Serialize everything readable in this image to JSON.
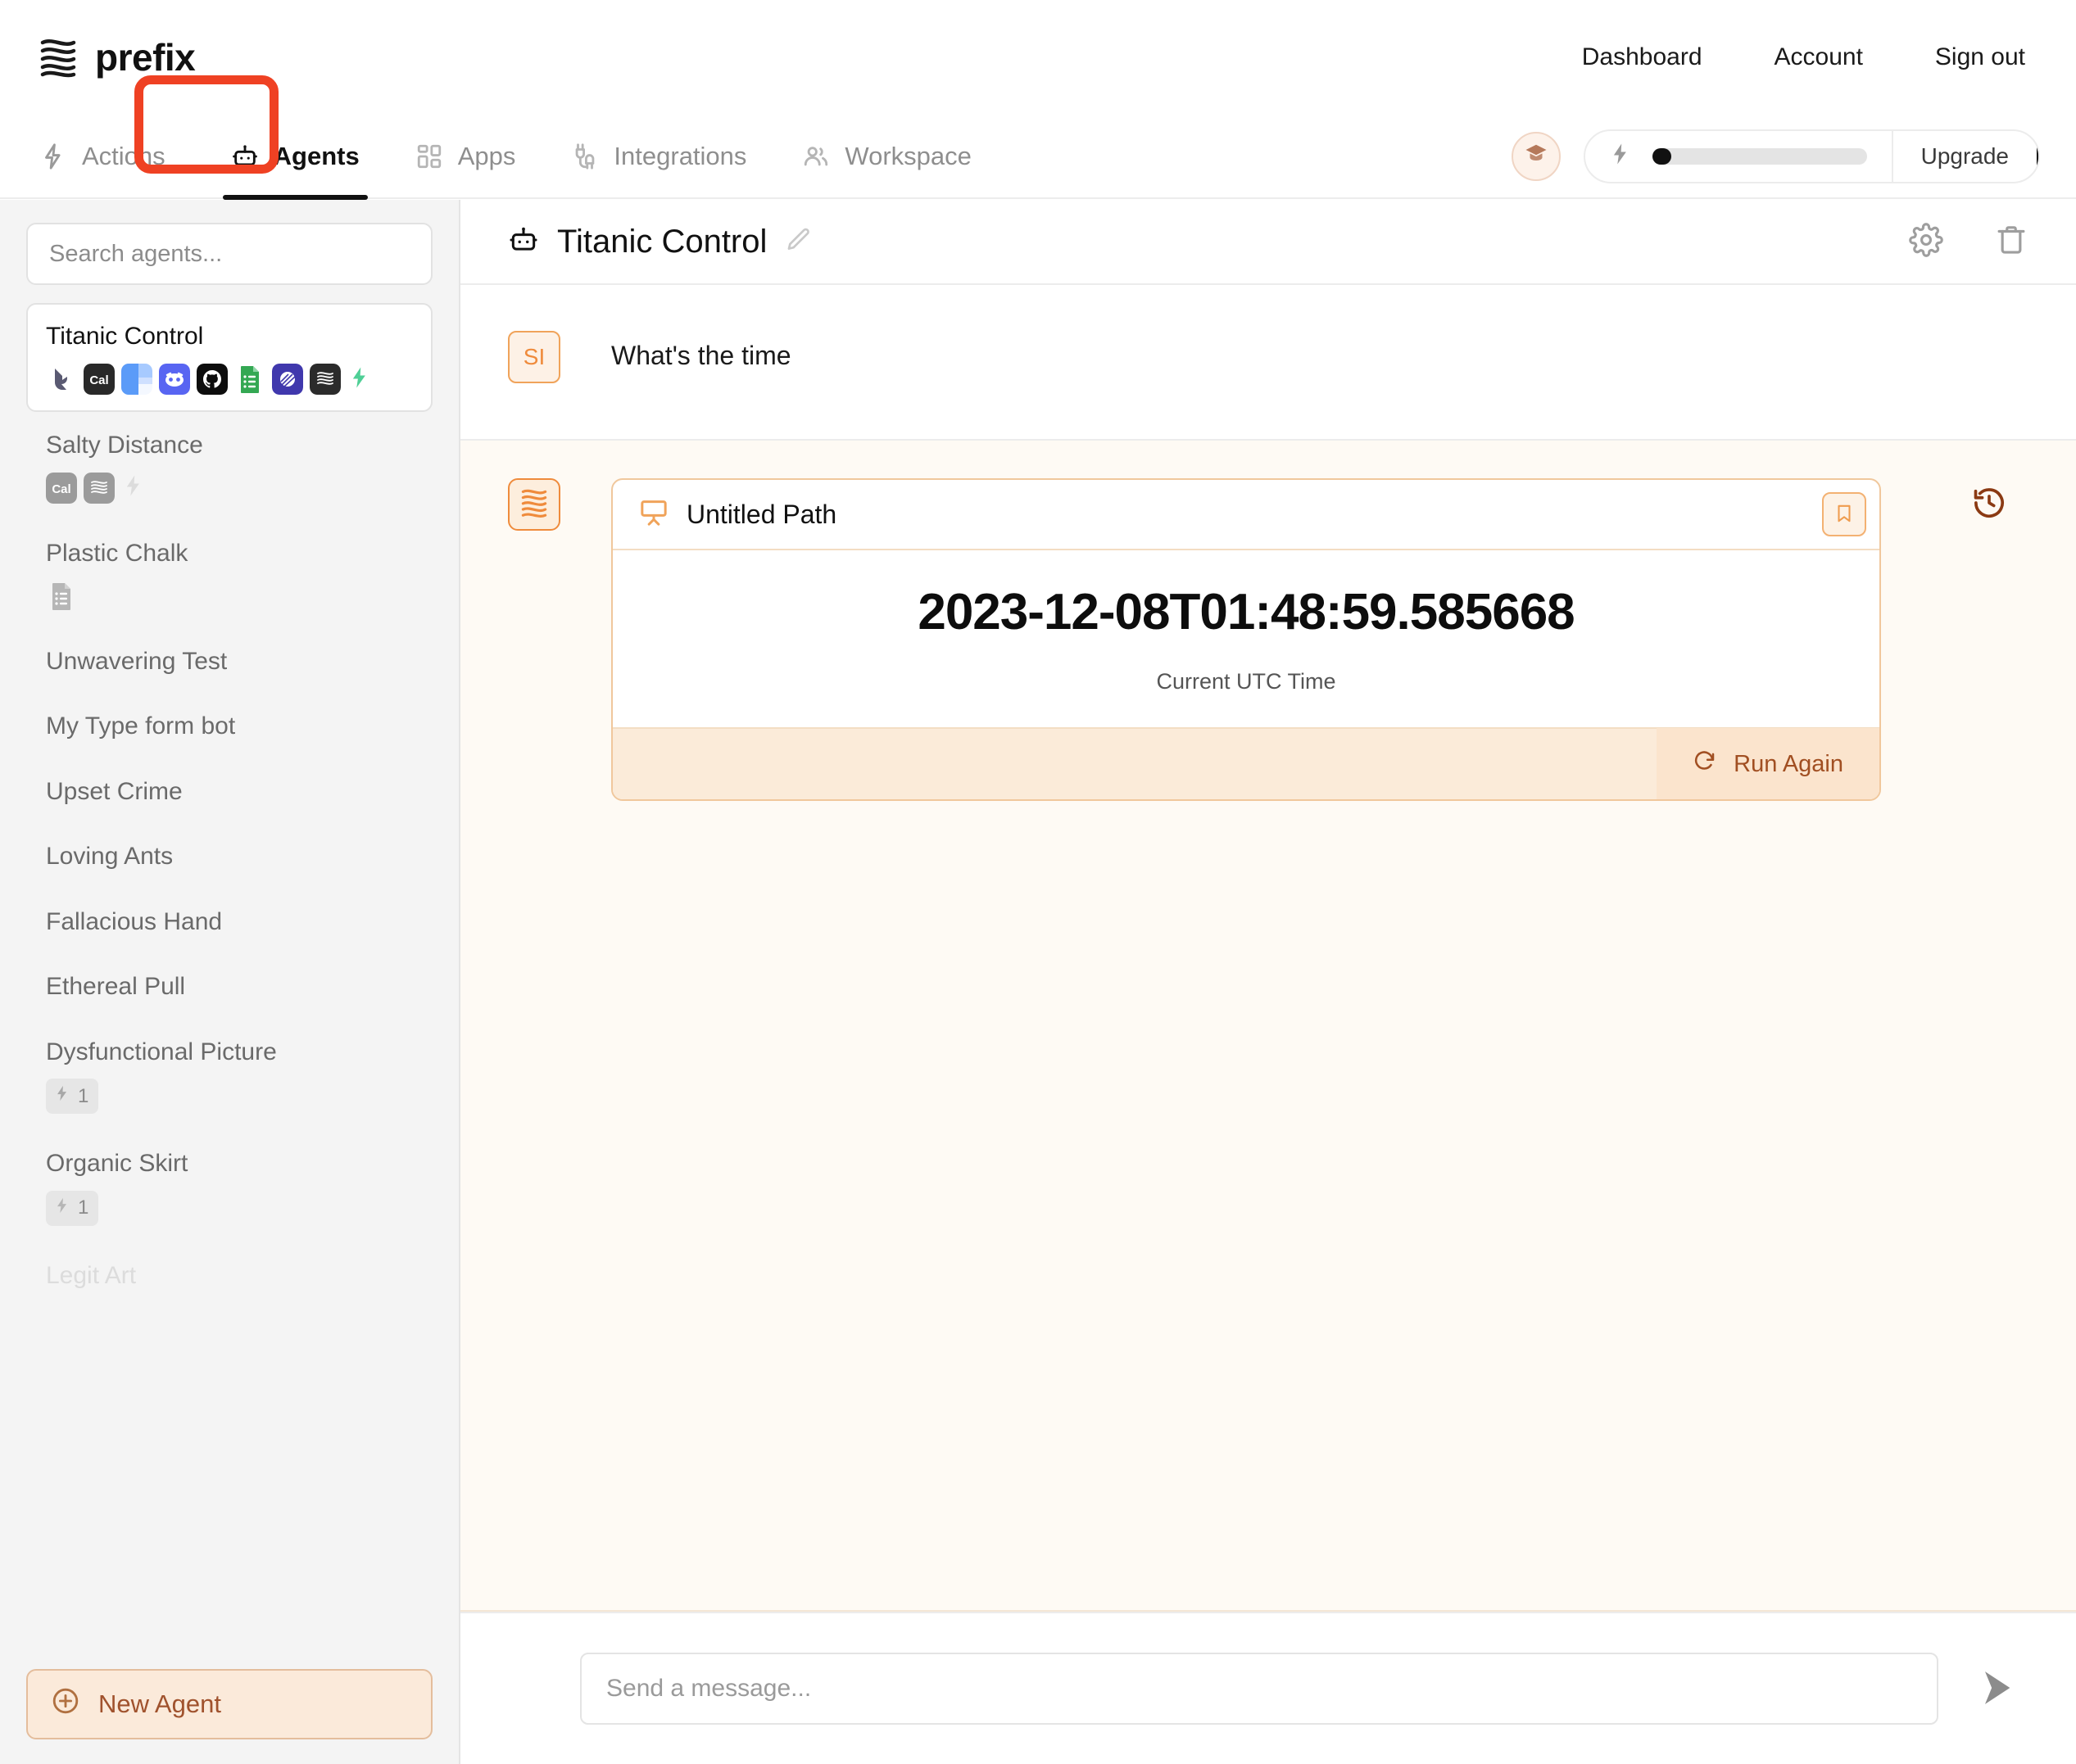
{
  "brand": {
    "name": "prefix",
    "logo_icon": "wavy-lines-logo"
  },
  "topnav": [
    {
      "label": "Dashboard",
      "name": "dashboard"
    },
    {
      "label": "Account",
      "name": "account"
    },
    {
      "label": "Sign out",
      "name": "sign-out"
    }
  ],
  "tabs": [
    {
      "label": "Actions",
      "icon": "lightning-icon",
      "active": false
    },
    {
      "label": "Agents",
      "icon": "robot-icon",
      "active": true
    },
    {
      "label": "Apps",
      "icon": "grid-icon",
      "active": false
    },
    {
      "label": "Integrations",
      "icon": "plug-icon",
      "active": false
    },
    {
      "label": "Workspace",
      "icon": "users-icon",
      "active": false
    }
  ],
  "annotation": {
    "target": "Agents",
    "color": "#ef4123"
  },
  "credits": {
    "badge_icon": "graduation-cap-icon",
    "bolt_icon": "lightning-icon",
    "fill_percent": 9,
    "upgrade_label": "Upgrade"
  },
  "sidebar": {
    "search": {
      "placeholder": "Search agents...",
      "value": ""
    },
    "agents": [
      {
        "name": "Titanic Control",
        "selected": true,
        "faded": false,
        "apps": [
          "bird-icon",
          "cal-icon",
          "microsoft-icon",
          "discord-icon",
          "github-icon",
          "google-sheets-icon",
          "purple-circle-icon",
          "prefix-dark-icon"
        ],
        "bolt": true,
        "count": null
      },
      {
        "name": "Salty Distance",
        "selected": false,
        "faded": false,
        "apps": [
          "cal-icon",
          "prefix-dark-icon"
        ],
        "bolt": true,
        "count": null
      },
      {
        "name": "Plastic Chalk",
        "selected": false,
        "faded": false,
        "apps": [
          "google-sheets-icon"
        ],
        "bolt": false,
        "count": null
      },
      {
        "name": "Unwavering Test",
        "selected": false,
        "faded": false,
        "apps": [],
        "bolt": false,
        "count": null
      },
      {
        "name": "My Type form bot",
        "selected": false,
        "faded": false,
        "apps": [],
        "bolt": false,
        "count": null
      },
      {
        "name": "Upset Crime",
        "selected": false,
        "faded": false,
        "apps": [],
        "bolt": false,
        "count": null
      },
      {
        "name": "Loving Ants",
        "selected": false,
        "faded": false,
        "apps": [],
        "bolt": false,
        "count": null
      },
      {
        "name": "Fallacious Hand",
        "selected": false,
        "faded": false,
        "apps": [],
        "bolt": false,
        "count": null
      },
      {
        "name": "Ethereal Pull",
        "selected": false,
        "faded": false,
        "apps": [],
        "bolt": false,
        "count": null
      },
      {
        "name": "Dysfunctional Picture",
        "selected": false,
        "faded": false,
        "apps": [],
        "bolt": false,
        "count": "1"
      },
      {
        "name": "Organic Skirt",
        "selected": false,
        "faded": false,
        "apps": [],
        "bolt": false,
        "count": "1"
      },
      {
        "name": "Legit Art",
        "selected": false,
        "faded": true,
        "apps": [],
        "bolt": false,
        "count": null
      }
    ],
    "new_agent_label": "New Agent",
    "new_agent_icon": "plus-circle-icon"
  },
  "main": {
    "header": {
      "icon": "robot-icon",
      "title": "Titanic Control",
      "edit_icon": "pencil-icon",
      "settings_icon": "gear-icon",
      "delete_icon": "trash-icon"
    },
    "user_message": {
      "avatar_initials": "SI",
      "text": "What's the time"
    },
    "agent_response": {
      "avatar_icon": "prefix-logo-icon",
      "card_icon": "presentation-icon",
      "card_title": "Untitled Path",
      "bookmark_icon": "bookmark-icon",
      "result_value": "2023-12-08T01:48:59.585668",
      "result_label": "Current UTC Time",
      "run_again_label": "Run Again",
      "run_again_icon": "refresh-icon",
      "history_icon": "history-icon"
    },
    "composer": {
      "placeholder": "Send a message...",
      "value": "",
      "send_icon": "send-arrow-icon"
    }
  },
  "colors": {
    "accent_orange": "#ef8b3c",
    "annotation_red": "#ef4123",
    "sidebar_bg": "#f4f4f4",
    "agent_bubble_bg": "#fefaf4"
  }
}
